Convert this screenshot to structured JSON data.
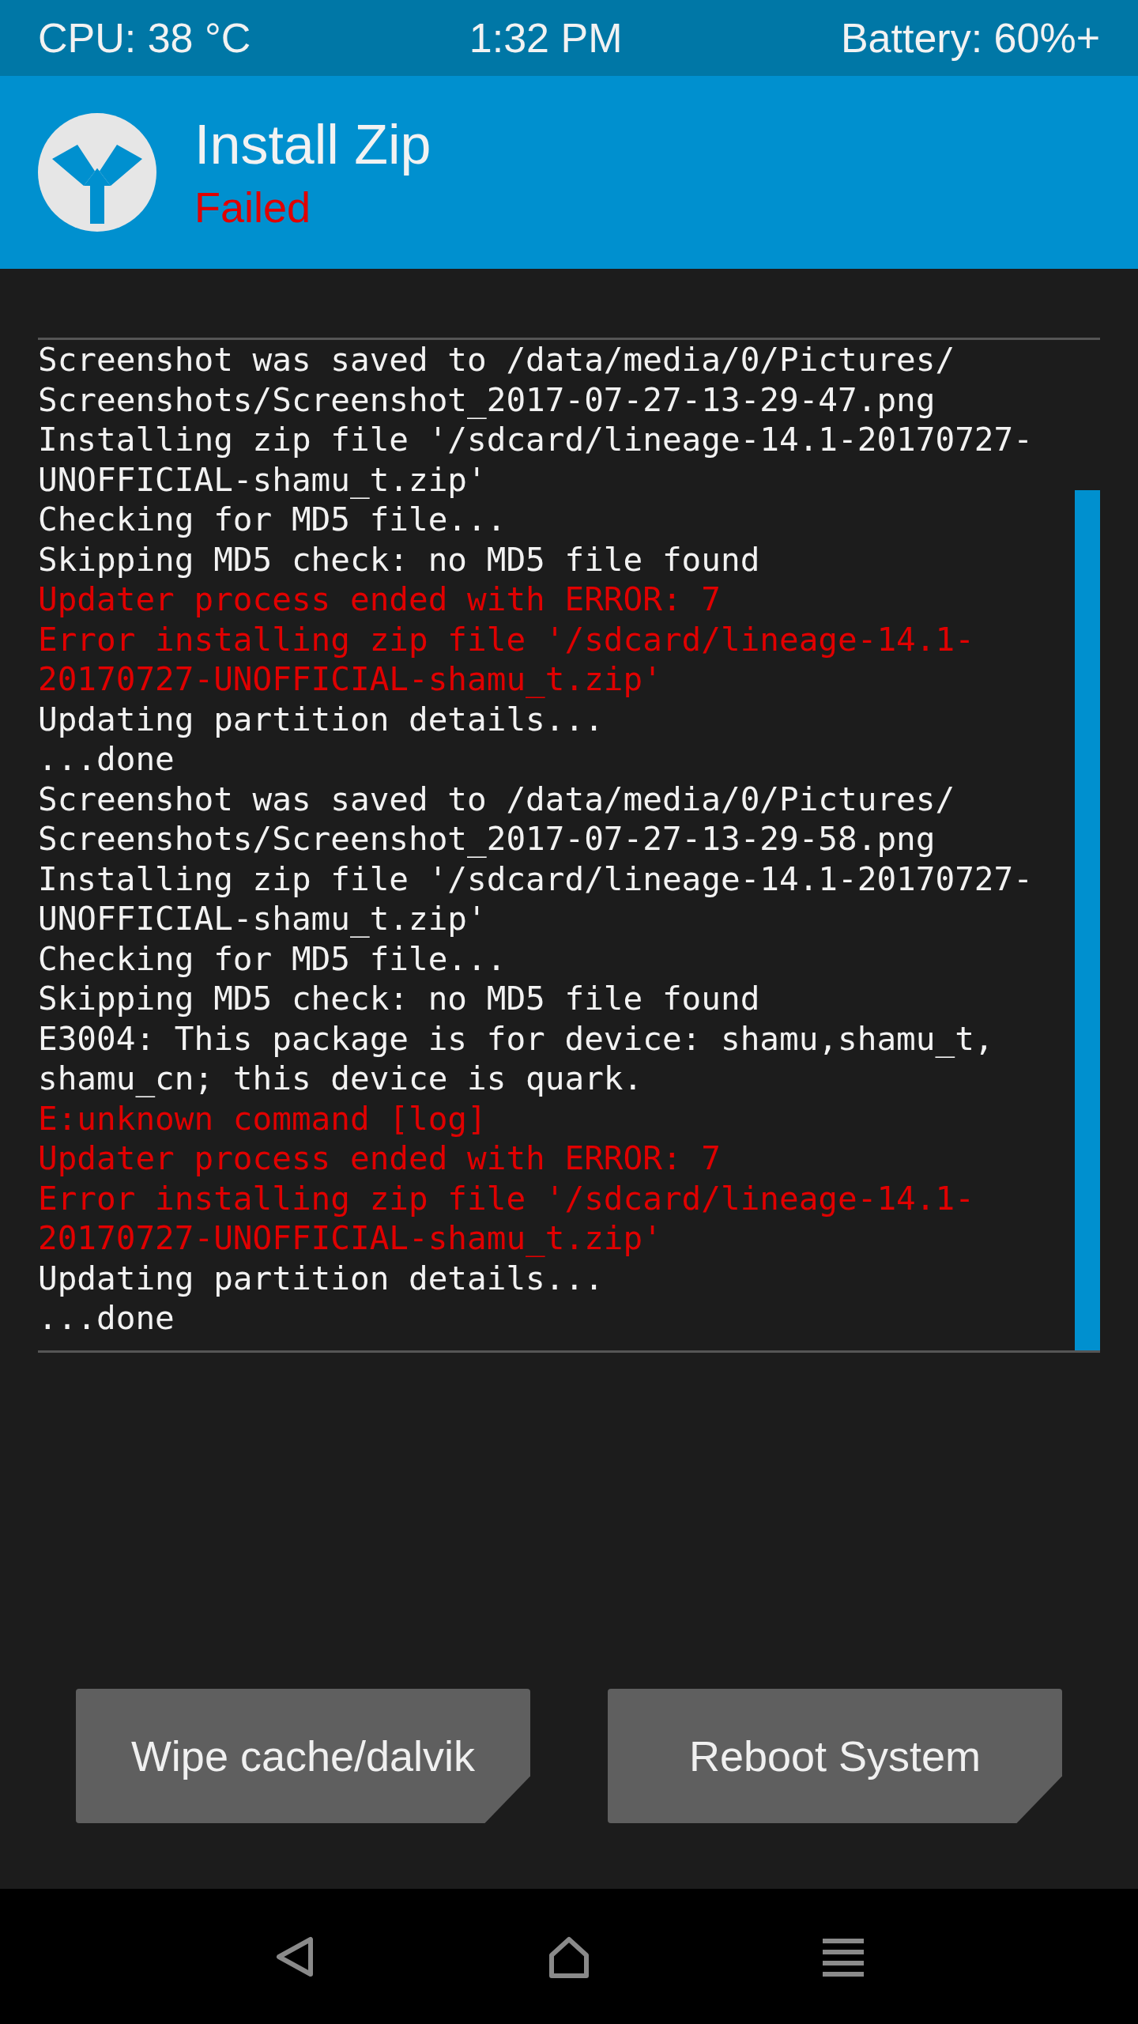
{
  "status_bar": {
    "cpu": "CPU: 38 °C",
    "time": "1:32 PM",
    "battery": "Battery: 60%+"
  },
  "header": {
    "title": "Install Zip",
    "status": "Failed"
  },
  "console": {
    "lines": [
      {
        "kind": "normal",
        "text": "Screenshot was saved to /data/media/0/Pictures/"
      },
      {
        "kind": "normal",
        "text": "Screenshots/Screenshot_2017-07-27-13-29-47.png"
      },
      {
        "kind": "normal",
        "text": "Installing zip file '/sdcard/lineage-14.1-20170727-"
      },
      {
        "kind": "normal",
        "text": "UNOFFICIAL-shamu_t.zip'"
      },
      {
        "kind": "normal",
        "text": "Checking for MD5 file..."
      },
      {
        "kind": "normal",
        "text": "Skipping MD5 check: no MD5 file found"
      },
      {
        "kind": "error",
        "text": "Updater process ended with ERROR: 7"
      },
      {
        "kind": "error",
        "text": "Error installing zip file '/sdcard/lineage-14.1-"
      },
      {
        "kind": "error",
        "text": "20170727-UNOFFICIAL-shamu_t.zip'"
      },
      {
        "kind": "normal",
        "text": "Updating partition details..."
      },
      {
        "kind": "normal",
        "text": "...done"
      },
      {
        "kind": "normal",
        "text": "Screenshot was saved to /data/media/0/Pictures/"
      },
      {
        "kind": "normal",
        "text": "Screenshots/Screenshot_2017-07-27-13-29-58.png"
      },
      {
        "kind": "normal",
        "text": "Installing zip file '/sdcard/lineage-14.1-20170727-"
      },
      {
        "kind": "normal",
        "text": "UNOFFICIAL-shamu_t.zip'"
      },
      {
        "kind": "normal",
        "text": "Checking for MD5 file..."
      },
      {
        "kind": "normal",
        "text": "Skipping MD5 check: no MD5 file found"
      },
      {
        "kind": "normal",
        "text": "E3004: This package is for device: shamu,shamu_t,"
      },
      {
        "kind": "normal",
        "text": "shamu_cn; this device is quark."
      },
      {
        "kind": "error",
        "text": "E:unknown command [log]"
      },
      {
        "kind": "error",
        "text": "Updater process ended with ERROR: 7"
      },
      {
        "kind": "error",
        "text": "Error installing zip file '/sdcard/lineage-14.1-"
      },
      {
        "kind": "error",
        "text": "20170727-UNOFFICIAL-shamu_t.zip'"
      },
      {
        "kind": "normal",
        "text": "Updating partition details..."
      },
      {
        "kind": "normal",
        "text": "...done"
      }
    ]
  },
  "buttons": [
    "Wipe cache/dalvik",
    "Reboot System"
  ]
}
